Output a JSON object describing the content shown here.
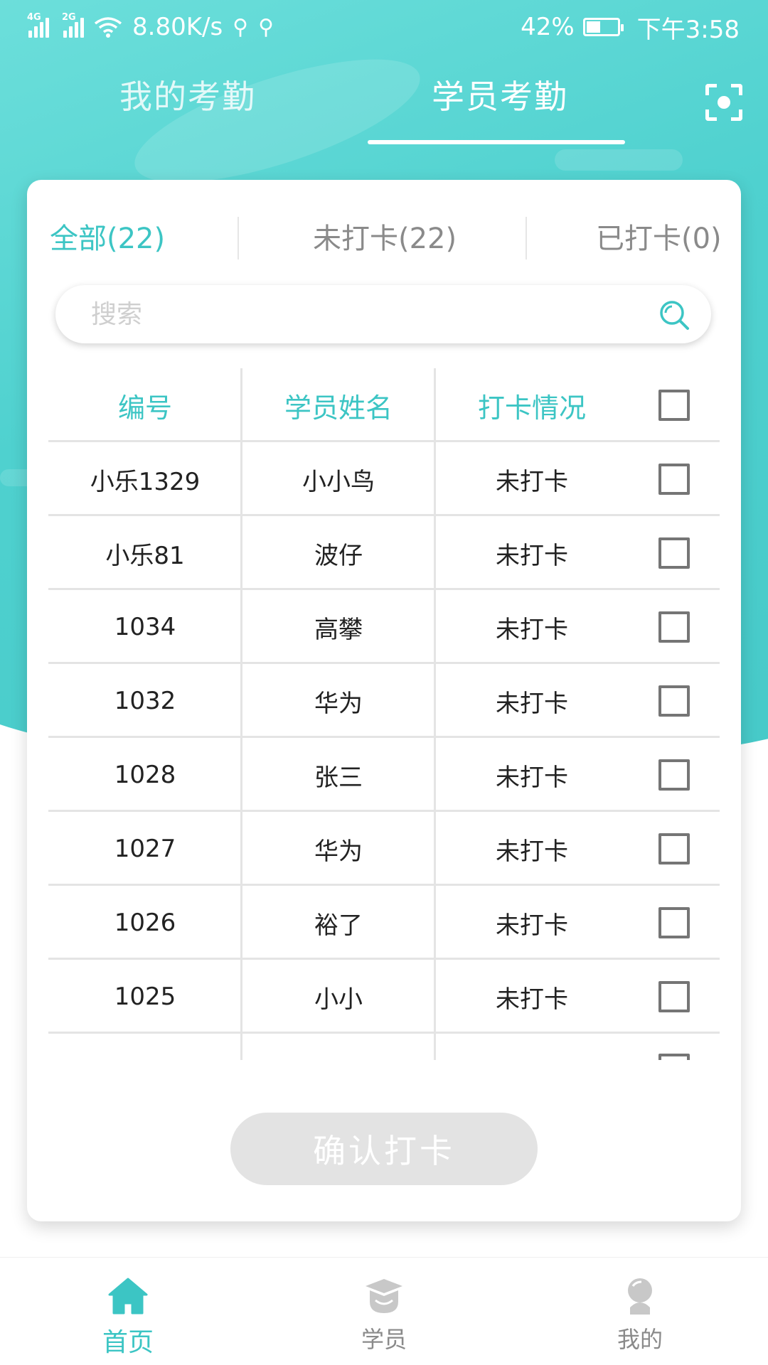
{
  "status_bar": {
    "net_speed": "8.80K/s",
    "signal1_label": "4G",
    "signal2_label": "2G",
    "battery": "42%",
    "time": "下午3:58"
  },
  "top_tabs": {
    "my_attendance": "我的考勤",
    "student_attendance": "学员考勤",
    "active": "学员考勤"
  },
  "filter_tabs": [
    {
      "label": "全部(22)",
      "active": true
    },
    {
      "label": "未打卡(22)",
      "active": false
    },
    {
      "label": "已打卡(0)",
      "active": false
    }
  ],
  "search": {
    "placeholder": "搜索",
    "value": ""
  },
  "table": {
    "headers": [
      "编号",
      "学员姓名",
      "打卡情况"
    ],
    "rows": [
      {
        "id": "小乐1329",
        "name": "小小鸟",
        "status": "未打卡",
        "checked": false
      },
      {
        "id": "小乐81",
        "name": "波仔",
        "status": "未打卡",
        "checked": false
      },
      {
        "id": "1034",
        "name": "高攀",
        "status": "未打卡",
        "checked": false
      },
      {
        "id": "1032",
        "name": "华为",
        "status": "未打卡",
        "checked": false
      },
      {
        "id": "1028",
        "name": "张三",
        "status": "未打卡",
        "checked": false
      },
      {
        "id": "1027",
        "name": "华为",
        "status": "未打卡",
        "checked": false
      },
      {
        "id": "1026",
        "name": "裕了",
        "status": "未打卡",
        "checked": false
      },
      {
        "id": "1025",
        "name": "小小",
        "status": "未打卡",
        "checked": false
      }
    ]
  },
  "confirm_button": "确认打卡",
  "bottom_nav": [
    {
      "label": "首页",
      "icon": "home-icon",
      "active": true
    },
    {
      "label": "学员",
      "icon": "graduation-cap-icon",
      "active": false
    },
    {
      "label": "我的",
      "icon": "person-icon",
      "active": false
    }
  ],
  "colors": {
    "accent": "#3cc5c4",
    "header_bg": "#4fd1cf",
    "inactive_text": "#8a8a8a",
    "disabled_button": "#e3e3e3"
  }
}
